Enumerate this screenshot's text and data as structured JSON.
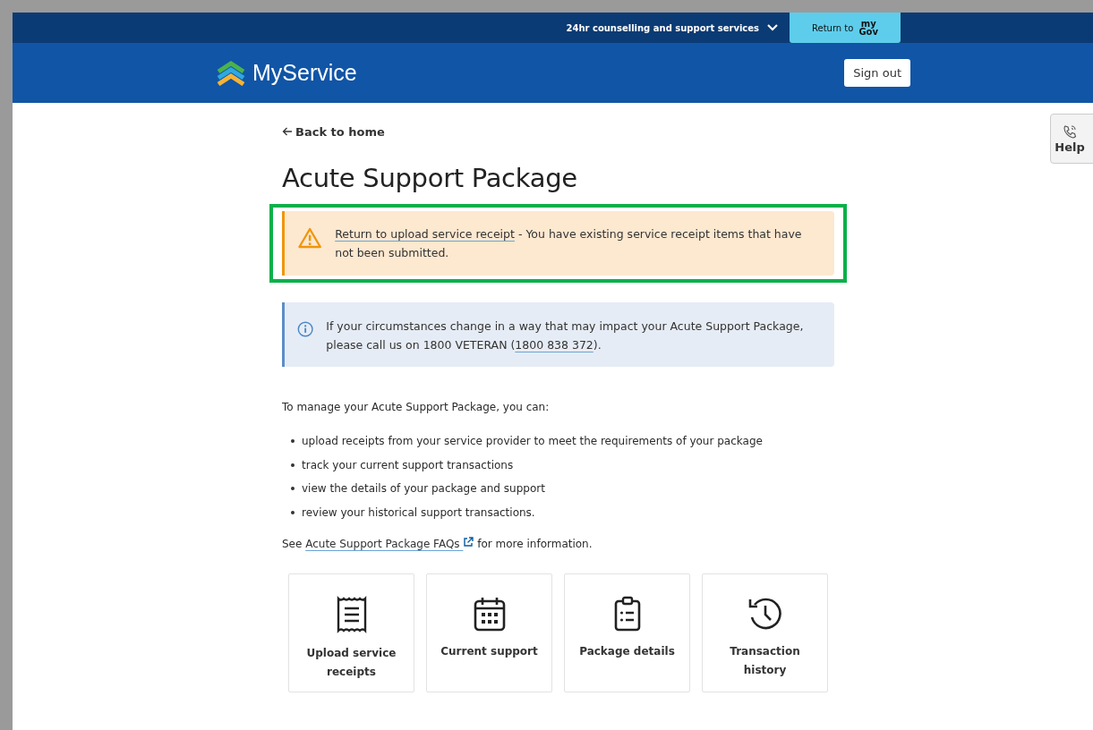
{
  "top_bar": {
    "support_menu": "24hr counselling and support services",
    "mygov_button": {
      "label": "Return to",
      "logo_top": "my",
      "logo_bottom": "Gov"
    }
  },
  "header": {
    "logo": "MyService",
    "sign_out": "Sign out"
  },
  "help_tab": {
    "label": "Help"
  },
  "back_link": "Back to home",
  "title": "Acute Support Package",
  "warning": {
    "highlighted": true,
    "link": "Return to upload service receipt",
    "text": " - You have existing service receipt items that have not been submitted."
  },
  "info": {
    "text": "If your circumstances change in a way that may impact your Acute Support Package, please call us on 1800 VETERAN (",
    "link": "1800 838 372",
    "text_after": ")."
  },
  "intro": "To manage your Acute Support Package, you can:",
  "bullets": [
    "upload receipts from your service provider to meet the requirements of your package",
    "track your current support transactions",
    "view the details of your package and support",
    "review your historical support transactions."
  ],
  "faq": {
    "before": "See ",
    "link": "Acute Support Package FAQs",
    "after": " for more information."
  },
  "tiles": [
    {
      "kind": "receipt",
      "label": "Upload service receipts"
    },
    {
      "kind": "calendar",
      "label": "Current support"
    },
    {
      "kind": "clipboard",
      "label": "Package details"
    },
    {
      "kind": "history",
      "label": "Transaction history"
    }
  ]
}
